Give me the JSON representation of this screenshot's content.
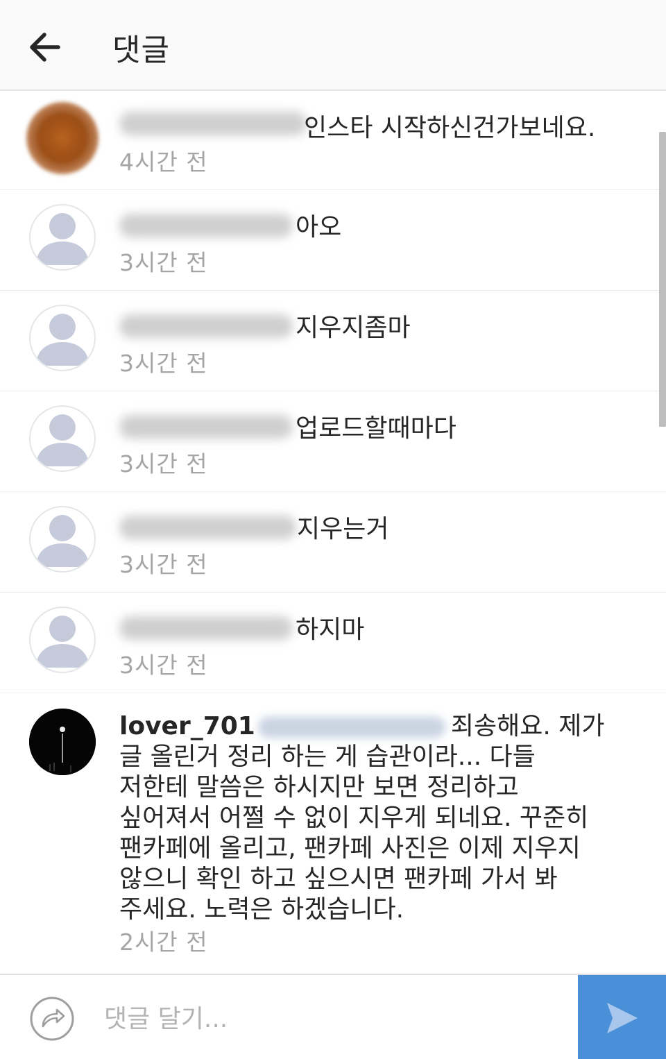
{
  "header": {
    "title": "댓글",
    "back_icon": "arrow-left-icon"
  },
  "comments": [
    {
      "text": "인스타 시작하신건가보네요.",
      "time": "4시간 전",
      "avatar": "orange"
    },
    {
      "text": "아오",
      "time": "3시간 전",
      "avatar": "default"
    },
    {
      "text": "지우지좀마",
      "time": "3시간 전",
      "avatar": "default"
    },
    {
      "text": "업로드할때마다",
      "time": "3시간 전",
      "avatar": "default"
    },
    {
      "text": "지우는거",
      "time": "3시간 전",
      "avatar": "default"
    },
    {
      "text": "하지마",
      "time": "3시간 전",
      "avatar": "default"
    }
  ],
  "reply": {
    "username": "lover_701",
    "lines": [
      "죄송해요. 제가",
      "글 올린거 정리 하는 게 습관이라... 다들",
      "저한테 말씀은 하시지만 보면 정리하고",
      "싶어져서 어쩔 수 없이 지우게 되네요. 꾸준히",
      "팬카페에 올리고, 팬카페 사진은 이제 지우지",
      "않으니 확인 하고 싶으시면 팬카페 가서 봐",
      "주세요. 노력은 하겠습니다."
    ],
    "time": "2시간 전"
  },
  "footer": {
    "placeholder": "댓글 달기...",
    "send_icon": "send-icon",
    "reply_icon": "reply-icon"
  },
  "colors": {
    "accent": "#4a90d9",
    "time_gray": "#a5a5a5",
    "text": "#262626",
    "avatar_gray": "#c5cbdb"
  }
}
